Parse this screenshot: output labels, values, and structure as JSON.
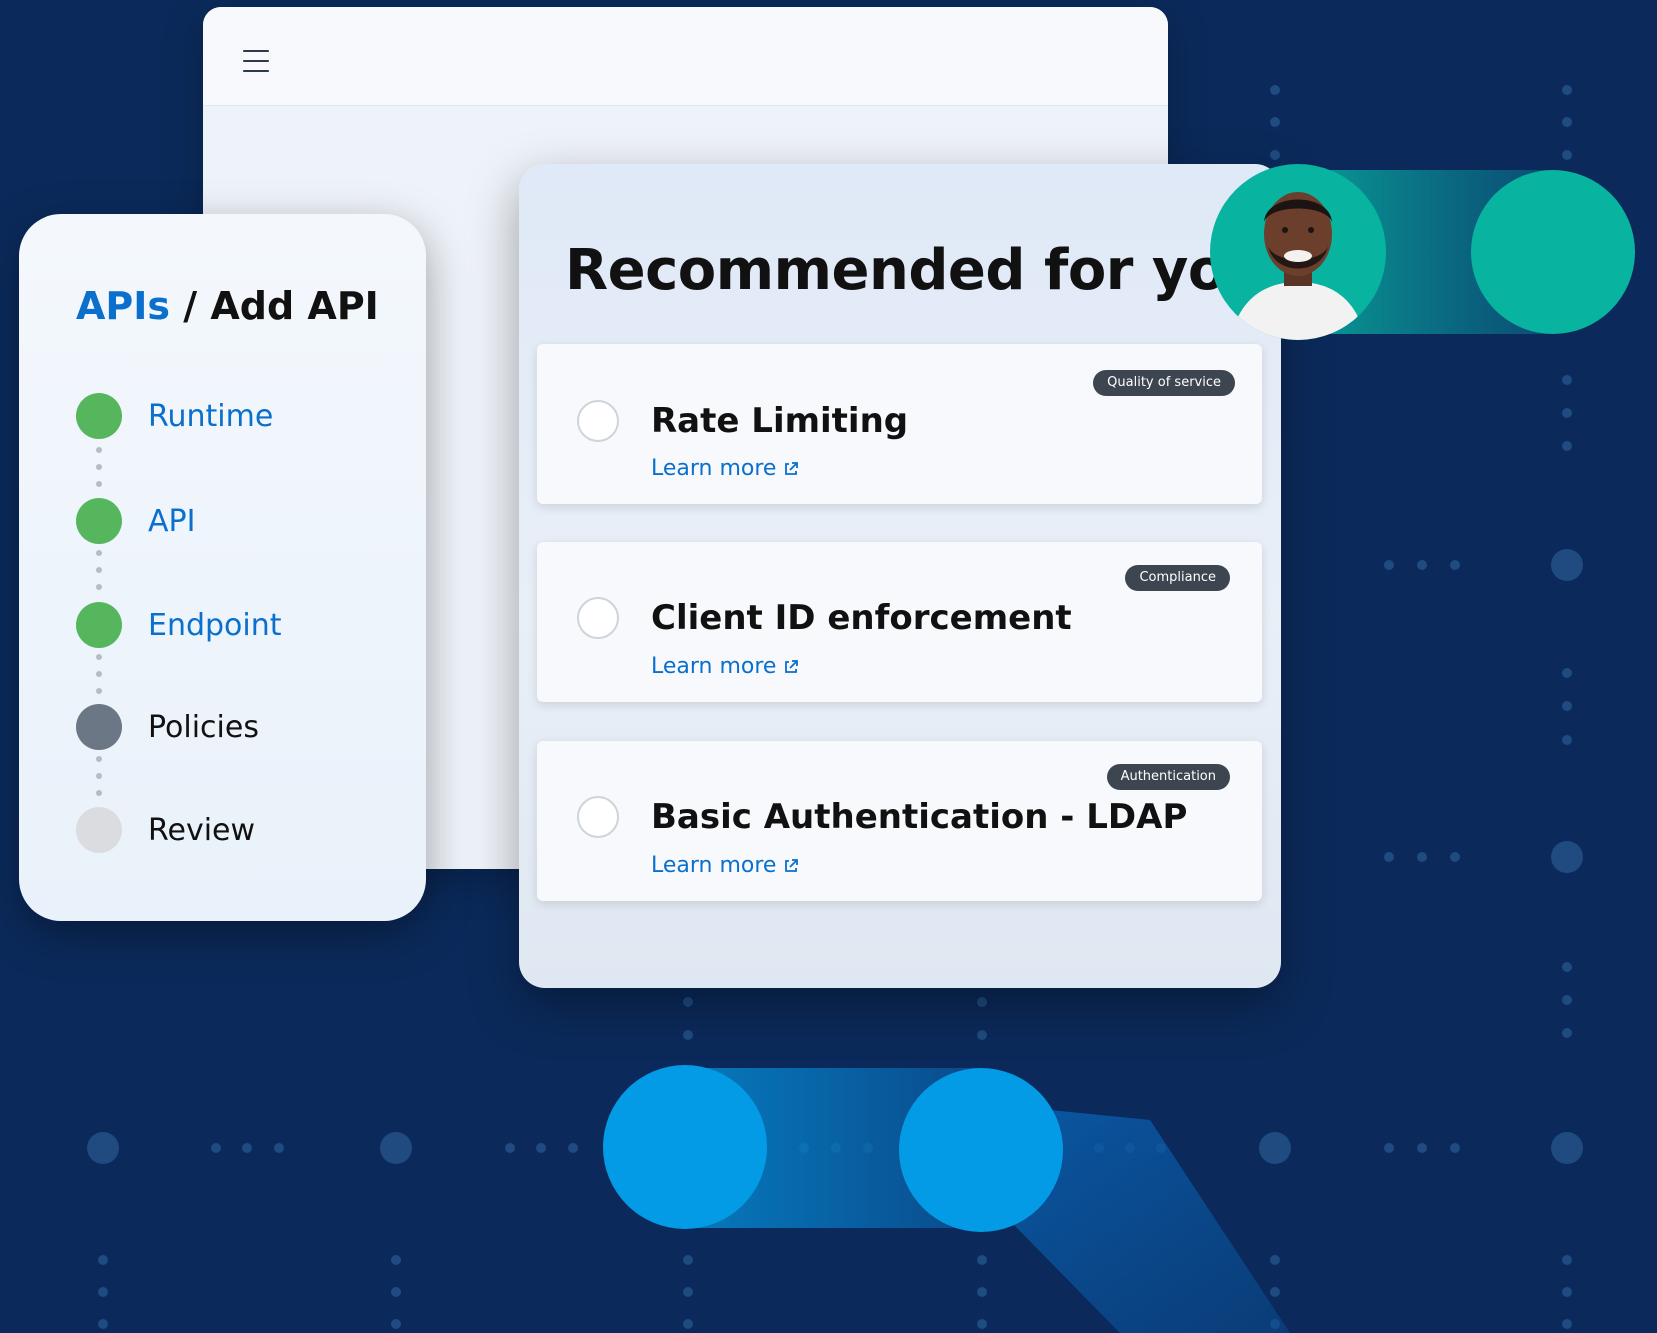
{
  "window": {
    "menu_icon": "hamburger-menu-icon"
  },
  "breadcrumb": {
    "parent": "APIs",
    "separator": " / ",
    "current": "Add API"
  },
  "steps": [
    {
      "label": "Runtime",
      "state": "done"
    },
    {
      "label": "API",
      "state": "done"
    },
    {
      "label": "Endpoint",
      "state": "done"
    },
    {
      "label": "Policies",
      "state": "current"
    },
    {
      "label": "Review",
      "state": "pending"
    }
  ],
  "recommendations": {
    "title": "Recommended for you",
    "items": [
      {
        "title": "Rate Limiting",
        "tag": "Quality of service",
        "link": "Learn more"
      },
      {
        "title": "Client ID enforcement",
        "tag": "Compliance",
        "link": "Learn more"
      },
      {
        "title": "Basic Authentication - LDAP",
        "tag": "Authentication",
        "link": "Learn more"
      }
    ]
  },
  "colors": {
    "background": "#0b2a5b",
    "accent_blue": "#0b6fcc",
    "step_done": "#56b65e",
    "step_current": "#6b7784",
    "step_pending": "#dadcdf",
    "teal": "#08b3a0",
    "bright_blue": "#039be5"
  }
}
